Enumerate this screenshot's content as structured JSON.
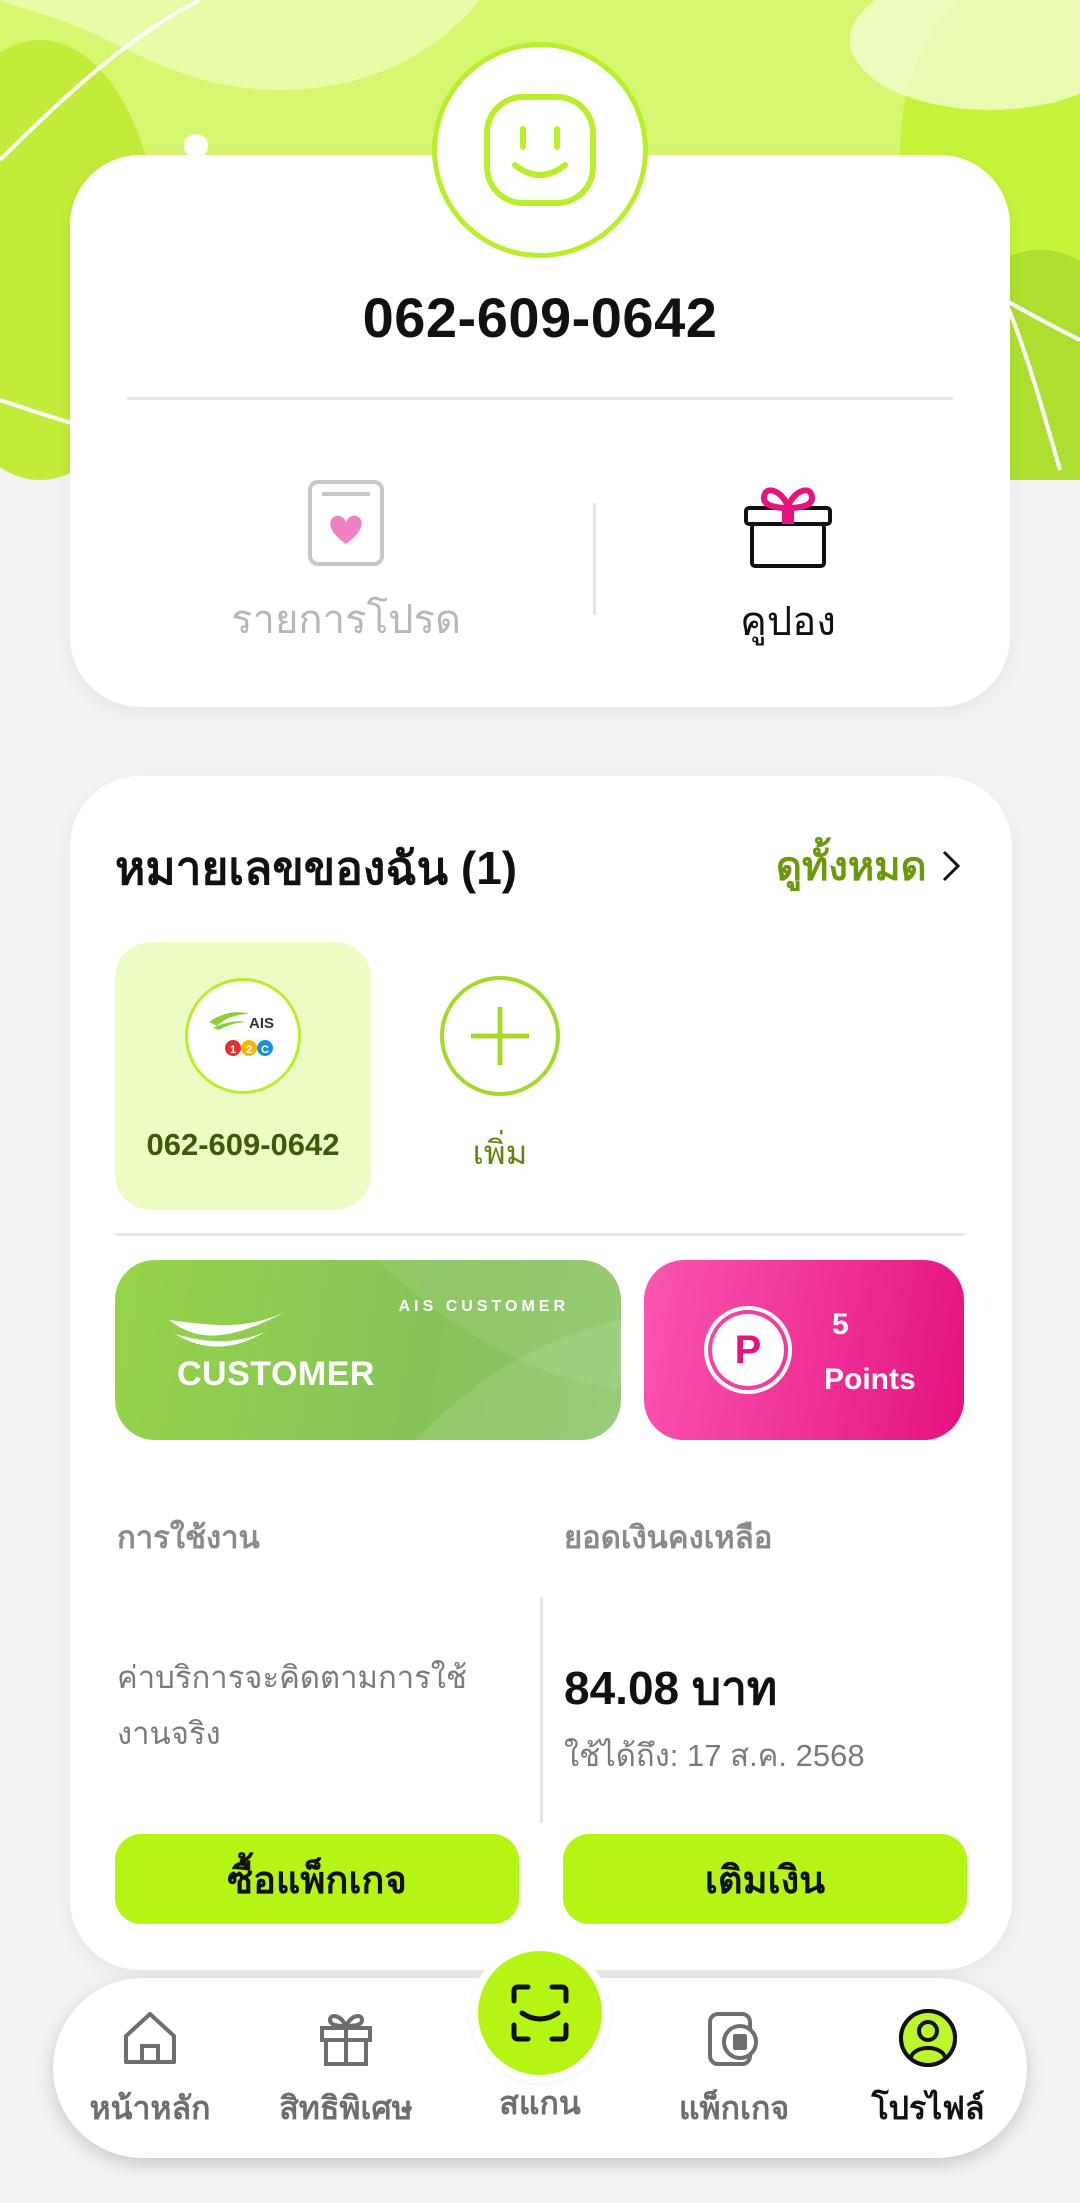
{
  "profile": {
    "phone_number": "062-609-0642",
    "favorites_label": "รายการโปรด",
    "coupon_label": "คูปอง"
  },
  "my_numbers": {
    "title": "หมายเลขของฉัน (1)",
    "see_all_label": "ดูทั้งหมด",
    "numbers": [
      {
        "number": "062-609-0642",
        "logo_text": "AIS",
        "logo_sub": "12C"
      }
    ],
    "add_label": "เพิ่ม"
  },
  "customer_card": {
    "small_label": "AIS CUSTOMER",
    "big_label": "CUSTOMER"
  },
  "points": {
    "icon_letter": "P",
    "value": "5",
    "unit": "Points"
  },
  "usage": {
    "label": "การใช้งาน",
    "description": "ค่าบริการจะคิดตามการใช้งานจริง"
  },
  "balance": {
    "label": "ยอดเงินคงเหลือ",
    "amount": "84.08 บาท",
    "expiry": "ใช้ได้ถึง: 17 ส.ค. 2568"
  },
  "actions": {
    "buy_package": "ซื้อแพ็กเกจ",
    "top_up": "เติมเงิน"
  },
  "nav": {
    "home": "หน้าหลัก",
    "privileges": "สิทธิพิเศษ",
    "scan": "สแกน",
    "packages": "แพ็กเกจ",
    "profile": "โปรไฟล์"
  },
  "colors": {
    "accent_green": "#b5f515",
    "dark_green_text": "#6a9a0a",
    "points_pink": "#e5127f",
    "customer_green": "#8cc853"
  }
}
